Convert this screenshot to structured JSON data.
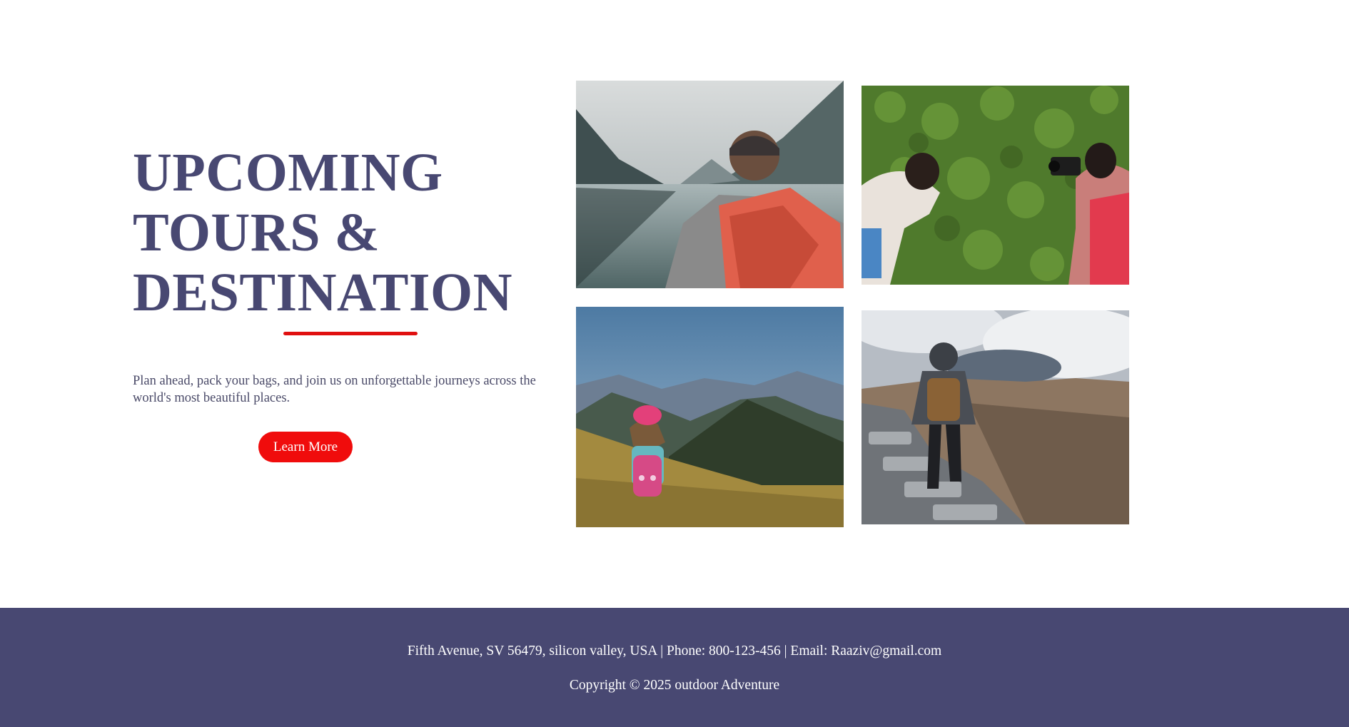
{
  "hero": {
    "title_lines": [
      "UPCOMING",
      "TOURS &",
      "DESTINATION"
    ],
    "description": "Plan ahead, pack your bags, and join us on unforgettable journeys across the world's most beautiful places.",
    "button_label": "Learn More"
  },
  "gallery": {
    "photos": [
      {
        "subject": "hiker with red backpack at mountain lake"
      },
      {
        "subject": "two women photographing green ivy wall"
      },
      {
        "subject": "girl with pink backpack on mountain meadow"
      },
      {
        "subject": "hiker walking on rocky mountain ridge"
      }
    ]
  },
  "footer": {
    "contact": "Fifth Avenue, SV 56479, silicon valley, USA | Phone: 800-123-456 | Email: Raaziv@gmail.com",
    "copyright": "Copyright © 2025 outdoor Adventure"
  },
  "colors": {
    "primary": "#484872",
    "accent": "#f00c0c",
    "background": "#ffffff"
  }
}
